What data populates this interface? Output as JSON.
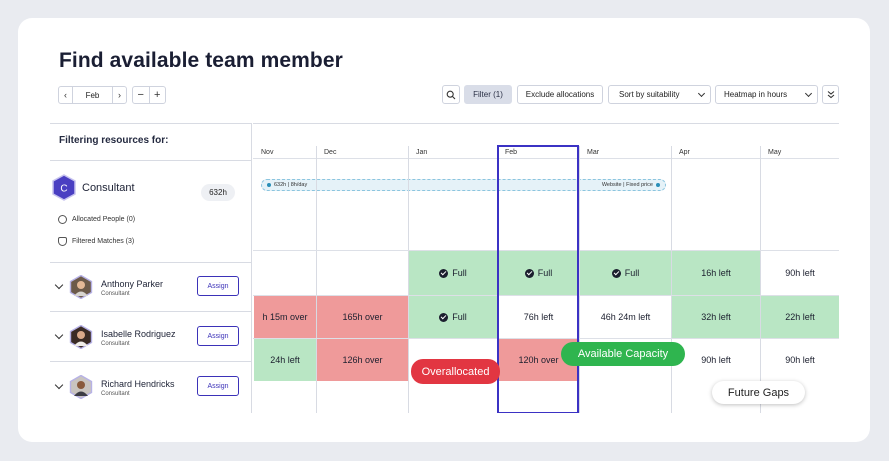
{
  "title": "Find available team member",
  "nav": {
    "month": "Feb",
    "prev_icon": "‹",
    "next_icon": "›",
    "zoom_out": "−",
    "zoom_in": "+"
  },
  "toolbar": {
    "filter": "Filter (1)",
    "exclude": "Exclude allocations",
    "sort": "Sort by suitability",
    "heatmap": "Heatmap in hours"
  },
  "left_panel": {
    "heading": "Filtering resources for:",
    "role": {
      "letter": "C",
      "name": "Consultant",
      "hours": "632h"
    },
    "allocated_people": "Allocated People (0)",
    "filtered_matches": "Filtered Matches (3)",
    "assign_label": "Assign",
    "people": [
      {
        "name": "Anthony Parker",
        "role": "Consultant"
      },
      {
        "name": "Isabelle Rodriguez",
        "role": "Consultant"
      },
      {
        "name": "Richard Hendricks",
        "role": "Consultant"
      }
    ]
  },
  "months": [
    "Nov",
    "Dec",
    "Jan",
    "Feb",
    "Mar",
    "Apr",
    "May"
  ],
  "allocation_bar": {
    "left": "632h | 8h/day",
    "right": "Website | Fixed price"
  },
  "heatmap": {
    "rows": [
      [
        {
          "text": "",
          "status": "white"
        },
        {
          "text": "",
          "status": "white"
        },
        {
          "text": "Full",
          "status": "green",
          "check": true
        },
        {
          "text": "Full",
          "status": "green",
          "check": true
        },
        {
          "text": "Full",
          "status": "green",
          "check": true
        },
        {
          "text": "16h left",
          "status": "green"
        },
        {
          "text": "90h left",
          "status": "white"
        }
      ],
      [
        {
          "text": "h 15m over",
          "status": "red"
        },
        {
          "text": "165h over",
          "status": "red"
        },
        {
          "text": "Full",
          "status": "green",
          "check": true
        },
        {
          "text": "76h left",
          "status": "white"
        },
        {
          "text": "46h 24m left",
          "status": "white"
        },
        {
          "text": "32h left",
          "status": "green"
        },
        {
          "text": "22h left",
          "status": "green"
        }
      ],
      [
        {
          "text": "24h left",
          "status": "green"
        },
        {
          "text": "126h over",
          "status": "red"
        },
        {
          "text": "",
          "status": "white"
        },
        {
          "text": "120h over",
          "status": "red"
        },
        {
          "text": "90h left",
          "status": "white"
        },
        {
          "text": "90h left",
          "status": "white"
        },
        {
          "text": "90h left",
          "status": "white"
        }
      ]
    ]
  },
  "callouts": {
    "overallocated": "Overallocated",
    "available": "Available Capacity",
    "future_gaps": "Future Gaps"
  },
  "colors": {
    "accent": "#3b32c4",
    "green": "#b9e6c4",
    "red": "#ef9a9a",
    "badge_red": "#e23642",
    "badge_green": "#2fb54f"
  }
}
